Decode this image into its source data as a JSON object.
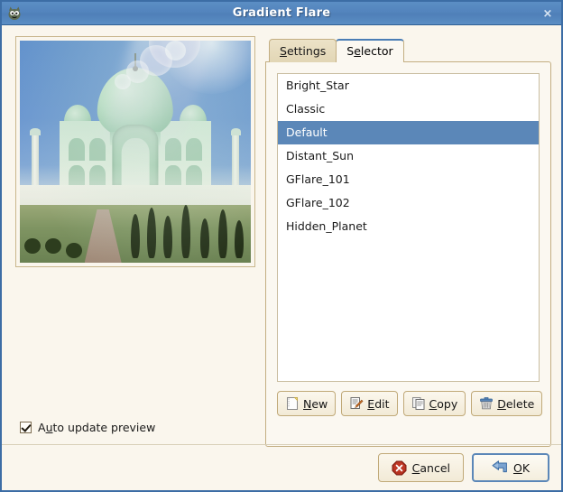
{
  "window": {
    "title": "Gradient Flare",
    "icon": "gimp-wilber-icon",
    "close_label": "×",
    "accent_blue": "#4a7db5",
    "titlebar_blue": "#5384bd",
    "background": "#faf6ed",
    "border_tan": "#c3ae82",
    "selection_blue": "#5b87b8"
  },
  "preview": {
    "label": "gradient-flare-preview",
    "description": "Taj Mahal photo with gradient flare effect applied"
  },
  "auto_update": {
    "checked": true,
    "label_before": "A",
    "label_mnemonic": "u",
    "label_after": "to update preview",
    "full_label": "Auto update preview"
  },
  "tabs": [
    {
      "label_before": "",
      "mnemonic": "S",
      "label_after": "ettings",
      "full_label": "Settings",
      "active": false
    },
    {
      "label_before": "S",
      "mnemonic": "e",
      "label_after": "lector",
      "full_label": "Selector",
      "active": true
    }
  ],
  "selector": {
    "items": [
      {
        "name": "Bright_Star",
        "selected": false
      },
      {
        "name": "Classic",
        "selected": false
      },
      {
        "name": "Default",
        "selected": true
      },
      {
        "name": "Distant_Sun",
        "selected": false
      },
      {
        "name": "GFlare_101",
        "selected": false
      },
      {
        "name": "GFlare_102",
        "selected": false
      },
      {
        "name": "Hidden_Planet",
        "selected": false
      }
    ],
    "buttons": [
      {
        "icon": "new-document-icon",
        "before": "",
        "mnemonic": "N",
        "after": "ew",
        "full_label": "New"
      },
      {
        "icon": "edit-pencil-icon",
        "before": "",
        "mnemonic": "E",
        "after": "dit",
        "full_label": "Edit"
      },
      {
        "icon": "copy-pages-icon",
        "before": "",
        "mnemonic": "C",
        "after": "opy",
        "full_label": "Copy"
      },
      {
        "icon": "trash-delete-icon",
        "before": "",
        "mnemonic": "D",
        "after": "elete",
        "full_label": "Delete"
      }
    ]
  },
  "actions": [
    {
      "icon": "cancel-octagon-icon",
      "before": "",
      "mnemonic": "C",
      "after": "ancel",
      "full_label": "Cancel",
      "default": false
    },
    {
      "icon": "ok-arrow-icon",
      "before": "",
      "mnemonic": "O",
      "after": "K",
      "full_label": "OK",
      "default": true
    }
  ]
}
